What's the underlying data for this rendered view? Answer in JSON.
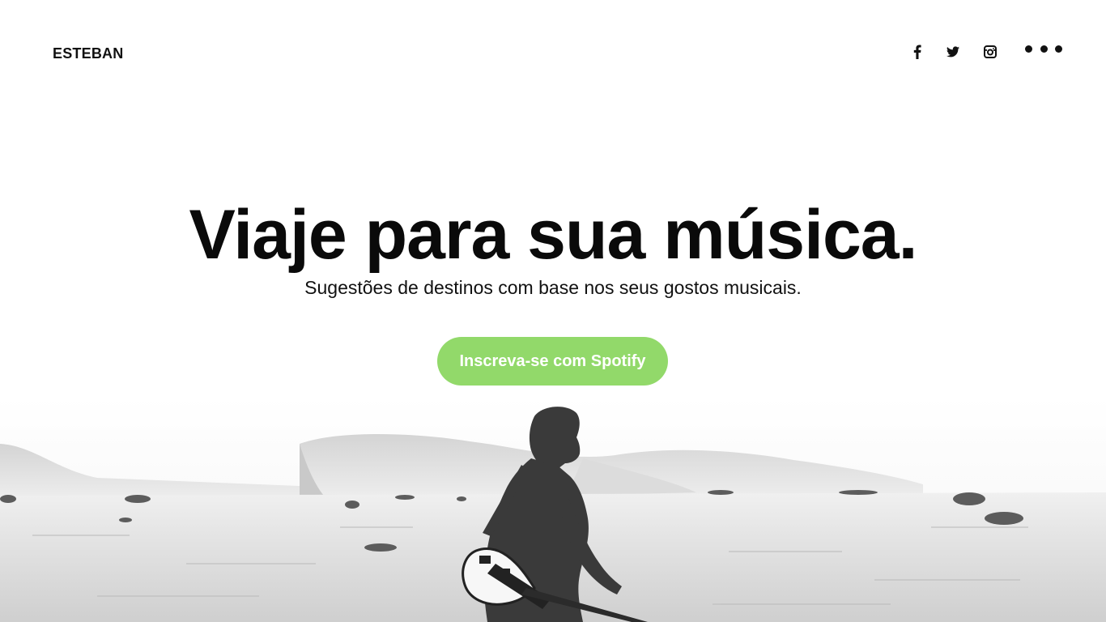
{
  "header": {
    "brand": "ESTEBAN",
    "social_icons": [
      "facebook-icon",
      "twitter-icon",
      "instagram-icon"
    ],
    "menu_icon": "more-dots-icon"
  },
  "hero": {
    "title": "Viaje para sua música.",
    "subtitle": "Sugestões de destinos com base nos seus gostos musicais.",
    "cta_label": "Inscreva-se com Spotify"
  },
  "colors": {
    "cta_background": "#92d96a",
    "cta_text": "#ffffff",
    "text": "#0a0a0a",
    "background": "#ffffff"
  },
  "image": {
    "subject": "desert-guitarist-photo"
  }
}
